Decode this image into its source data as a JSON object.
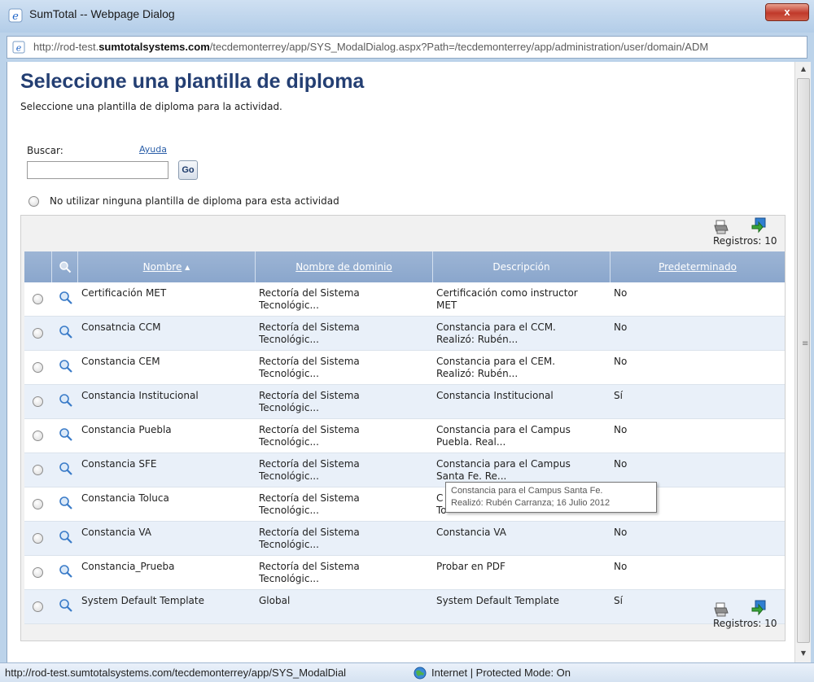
{
  "window": {
    "title": "SumTotal -- Webpage Dialog",
    "close_label": "x",
    "address_prefix": "http://rod-test.",
    "address_domain": "sumtotalsystems.com",
    "address_suffix": "/tecdemonterrey/app/SYS_ModalDialog.aspx?Path=/tecdemonterrey/app/administration/user/domain/ADM"
  },
  "page": {
    "title": "Seleccione una plantilla de diploma",
    "subtitle": "Seleccione una plantilla de diploma para la actividad."
  },
  "search": {
    "label": "Buscar:",
    "help_link": "Ayuda",
    "value": "",
    "go_label": "Go"
  },
  "no_template_option": "No utilizar ninguna plantilla de diploma para esta actividad",
  "records_label": "Registros: 10",
  "table": {
    "columns": {
      "name": "Nombre",
      "sort_indicator": "▲",
      "domain": "Nombre de dominio",
      "description": "Descripción",
      "default": "Predeterminado"
    },
    "rows": [
      {
        "name": "Certificación MET",
        "domain_line1": "Rectoría del Sistema",
        "domain_line2": "Tecnológic...",
        "desc_line1": "Certificación como instructor",
        "desc_line2": "MET",
        "default": "No"
      },
      {
        "name": "Consatncia CCM",
        "domain_line1": "Rectoría del Sistema",
        "domain_line2": "Tecnológic...",
        "desc_line1": "Constancia para el CCM.",
        "desc_line2": "Realizó: Rubén...",
        "default": "No"
      },
      {
        "name": "Constancia CEM",
        "domain_line1": "Rectoría del Sistema",
        "domain_line2": "Tecnológic...",
        "desc_line1": "Constancia para el CEM.",
        "desc_line2": "Realizó: Rubén...",
        "default": "No"
      },
      {
        "name": "Constancia Institucional",
        "domain_line1": "Rectoría del Sistema",
        "domain_line2": "Tecnológic...",
        "desc_line1": "Constancia Institucional",
        "desc_line2": "",
        "default": "Sí"
      },
      {
        "name": "Constancia Puebla",
        "domain_line1": "Rectoría del Sistema",
        "domain_line2": "Tecnológic...",
        "desc_line1": "Constancia para el Campus",
        "desc_line2": "Puebla. Real...",
        "default": "No"
      },
      {
        "name": "Constancia SFE",
        "domain_line1": "Rectoría del Sistema",
        "domain_line2": "Tecnológic...",
        "desc_line1": "Constancia para el Campus",
        "desc_line2": "Santa Fe. Re...",
        "default": "No"
      },
      {
        "name": "Constancia Toluca",
        "domain_line1": "Rectoría del Sistema",
        "domain_line2": "Tecnológic...",
        "desc_line1": "C",
        "desc_line2": "To",
        "default": ""
      },
      {
        "name": "Constancia VA",
        "domain_line1": "Rectoría del Sistema",
        "domain_line2": "Tecnológic...",
        "desc_line1": "Constancia VA",
        "desc_line2": "",
        "default": "No"
      },
      {
        "name": "Constancia_Prueba",
        "domain_line1": "Rectoría del Sistema",
        "domain_line2": "Tecnológic...",
        "desc_line1": "Probar en PDF",
        "desc_line2": "",
        "default": "No"
      },
      {
        "name": "System Default Template",
        "domain_line1": "Global",
        "domain_line2": "",
        "desc_line1": "System Default Template",
        "desc_line2": "",
        "default": "Sí"
      }
    ]
  },
  "tooltip": {
    "line1": "Constancia para el Campus Santa Fe.",
    "line2": "Realizó: Rubén Carranza; 16 Julio 2012"
  },
  "statusbar": {
    "url": "http://rod-test.sumtotalsystems.com/tecdemonterrey/app/SYS_ModalDial",
    "zone": "Internet | Protected Mode: On"
  },
  "colors": {
    "header_blue": "#8aa6cc",
    "title_blue": "#243f73",
    "row_alt": "#e9f0f9",
    "link_blue": "#2a5ea8"
  },
  "icons": [
    "ie-icon",
    "close-icon",
    "print-icon",
    "export-icon",
    "magnifier-icon",
    "globe-icon"
  ]
}
